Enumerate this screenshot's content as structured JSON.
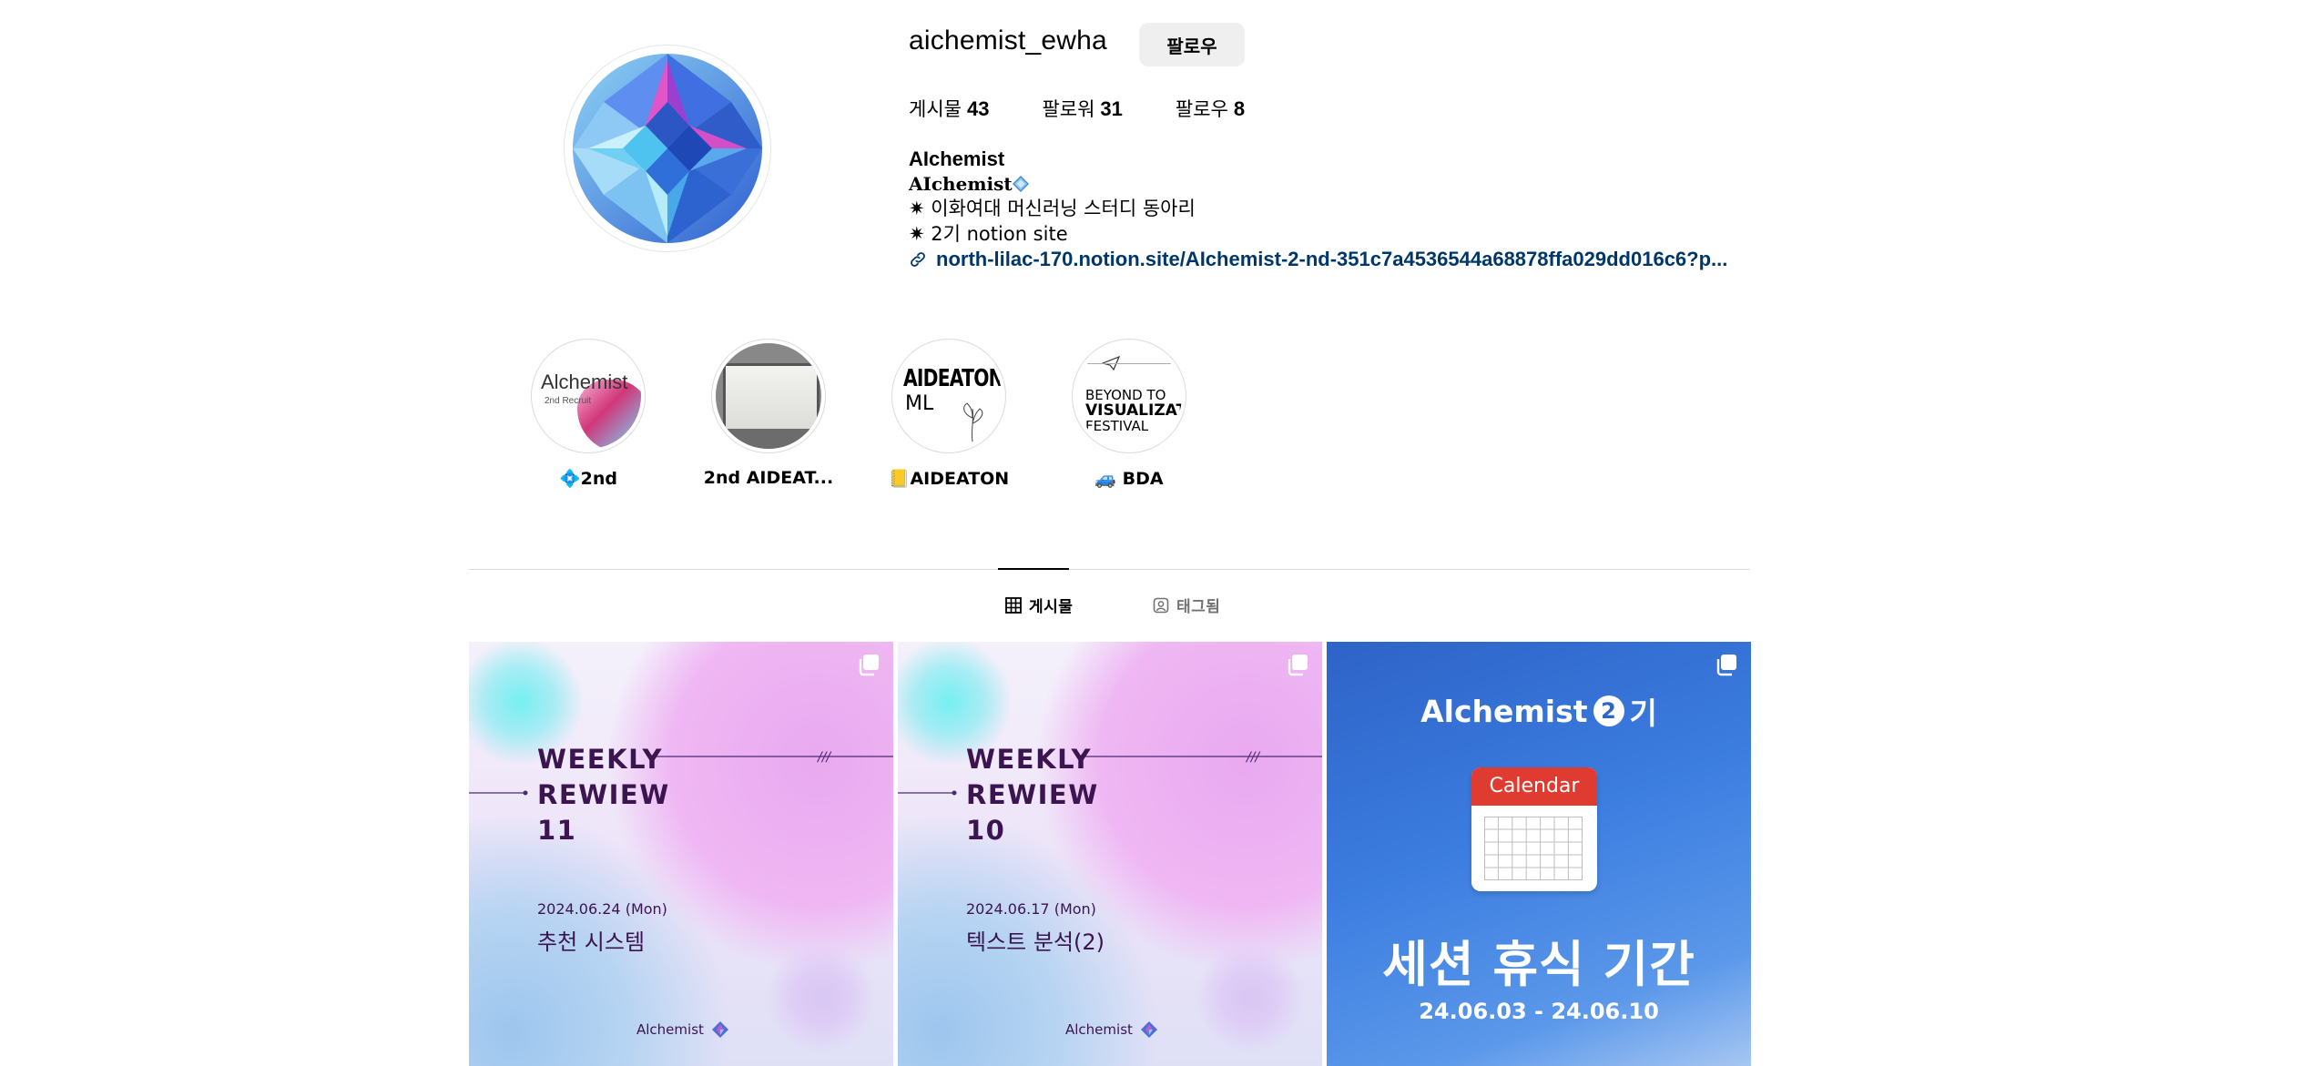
{
  "profile": {
    "username": "aichemist_ewha",
    "follow_label": "팔로우",
    "stats": [
      {
        "label": "게시물",
        "value": "43"
      },
      {
        "label": "팔로워",
        "value": "31"
      },
      {
        "label": "팔로우",
        "value": "8"
      }
    ],
    "bio": {
      "name": "AIchemist",
      "styled_name": "AIchemist",
      "line1": "✷ 이화여대 머신러닝 스터디 동아리",
      "line2": "✷ 2기 notion site",
      "link": "north-lilac-170.notion.site/AIchemist-2-nd-351c7a4536544a68878ffa029dd016c6?p..."
    }
  },
  "highlights": [
    {
      "label": "💠2nd",
      "cover_text": "Alchemist",
      "cover_subtext": "2nd Recruit"
    },
    {
      "label": "2nd AIDEAT...",
      "cover_text": ""
    },
    {
      "label": "📒AIDEATON",
      "cover_text": "AIDEATON",
      "cover_subtext": "ML"
    },
    {
      "label": "🚙 BDA",
      "cover_text": "BEYOND TO",
      "cover_text2": "VISUALIZATI",
      "cover_text3": "FESTIVAL"
    }
  ],
  "tabs": [
    {
      "label": "게시물",
      "icon": "grid-icon",
      "active": true
    },
    {
      "label": "태그됨",
      "icon": "tagged-icon",
      "active": false
    }
  ],
  "posts": [
    {
      "title_lines": [
        "WEEKLY",
        "REWIEW",
        "11"
      ],
      "date": "2024.06.24 (Mon)",
      "subtitle": "추천 시스템",
      "brand": "Alchemist"
    },
    {
      "title_lines": [
        "WEEKLY",
        "REWIEW",
        "10"
      ],
      "date": "2024.06.17 (Mon)",
      "subtitle": "텍스트 분석(2)",
      "brand": "Alchemist"
    },
    {
      "head": "Alchemist",
      "head_num": "2",
      "head_suffix": "기",
      "calendar_label": "Calendar",
      "title": "세션 휴식 기간",
      "date": "24.06.03 - 24.06.10"
    }
  ],
  "colors": {
    "link": "#00376b",
    "post_text": "#3b1450",
    "notice_blue": "#3c7de0",
    "calendar_red": "#df3b30"
  }
}
